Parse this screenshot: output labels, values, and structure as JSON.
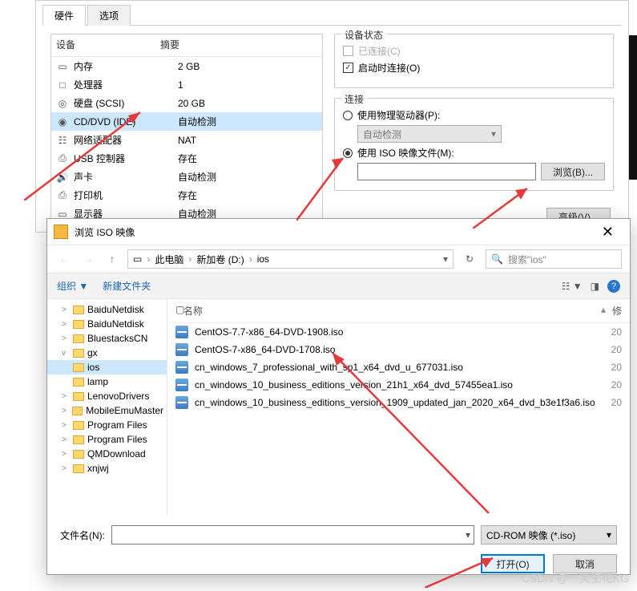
{
  "vm": {
    "tabs": {
      "hardware": "硬件",
      "options": "选项"
    },
    "headers": {
      "device": "设备",
      "summary": "摘要"
    },
    "devices": [
      {
        "icon": "▭",
        "name": "内存",
        "summary": "2 GB"
      },
      {
        "icon": "□",
        "name": "处理器",
        "summary": "1"
      },
      {
        "icon": "◎",
        "name": "硬盘 (SCSI)",
        "summary": "20 GB"
      },
      {
        "icon": "◉",
        "name": "CD/DVD (IDE)",
        "summary": "自动检测",
        "selected": true
      },
      {
        "icon": "☷",
        "name": "网络适配器",
        "summary": "NAT"
      },
      {
        "icon": "⎙",
        "name": "USB 控制器",
        "summary": "存在"
      },
      {
        "icon": "🔊",
        "name": "声卡",
        "summary": "自动检测"
      },
      {
        "icon": "⎙",
        "name": "打印机",
        "summary": "存在"
      },
      {
        "icon": "▭",
        "name": "显示器",
        "summary": "自动检测"
      }
    ],
    "status": {
      "legend": "设备状态",
      "connected": "已连接(C)",
      "connect_on_power": "启动时连接(O)"
    },
    "connection": {
      "legend": "连接",
      "physical": "使用物理驱动器(P):",
      "auto_detect": "自动检测",
      "iso": "使用 ISO 映像文件(M):",
      "browse": "浏览(B)..."
    },
    "advanced": "高级(V)..."
  },
  "dlg": {
    "title": "浏览 ISO 映像",
    "crumbs": [
      "此电脑",
      "新加卷 (D:)",
      "ios"
    ],
    "search_placeholder": "搜索\"ios\"",
    "toolbar": {
      "organize": "组织",
      "new_folder": "新建文件夹"
    },
    "tree": [
      {
        "label": "BaiduNetdisk",
        "exp": ">"
      },
      {
        "label": "BaiduNetdisk",
        "exp": ">"
      },
      {
        "label": "BluestacksCN",
        "exp": ">"
      },
      {
        "label": "gx",
        "exp": "v"
      },
      {
        "label": "ios",
        "exp": "",
        "selected": true
      },
      {
        "label": "lamp",
        "exp": ""
      },
      {
        "label": "LenovoDrivers",
        "exp": ">"
      },
      {
        "label": "MobileEmuMaster",
        "exp": ">"
      },
      {
        "label": "Program Files",
        "exp": ">"
      },
      {
        "label": "Program Files",
        "exp": ">"
      },
      {
        "label": "QMDownload",
        "exp": ">"
      },
      {
        "label": "xnjwj",
        "exp": ">"
      }
    ],
    "columns": {
      "name": "名称",
      "date": "修"
    },
    "files": [
      "CentOS-7.7-x86_64-DVD-1908.iso",
      "CentOS-7-x86_64-DVD-1708.iso",
      "cn_windows_7_professional_with_sp1_x64_dvd_u_677031.iso",
      "cn_windows_10_business_editions_version_21h1_x64_dvd_57455ea1.iso",
      "cn_windows_10_business_editions_version_1909_updated_jan_2020_x64_dvd_b3e1f3a6.iso"
    ],
    "file_dates": [
      "20",
      "20",
      "20",
      "20",
      "20"
    ],
    "filename_label": "文件名(N):",
    "filter": "CD-ROM 映像 (*.iso)",
    "open": "打开(O)",
    "cancel": "取消"
  },
  "watermark": "CSDN @一笑生花KG"
}
